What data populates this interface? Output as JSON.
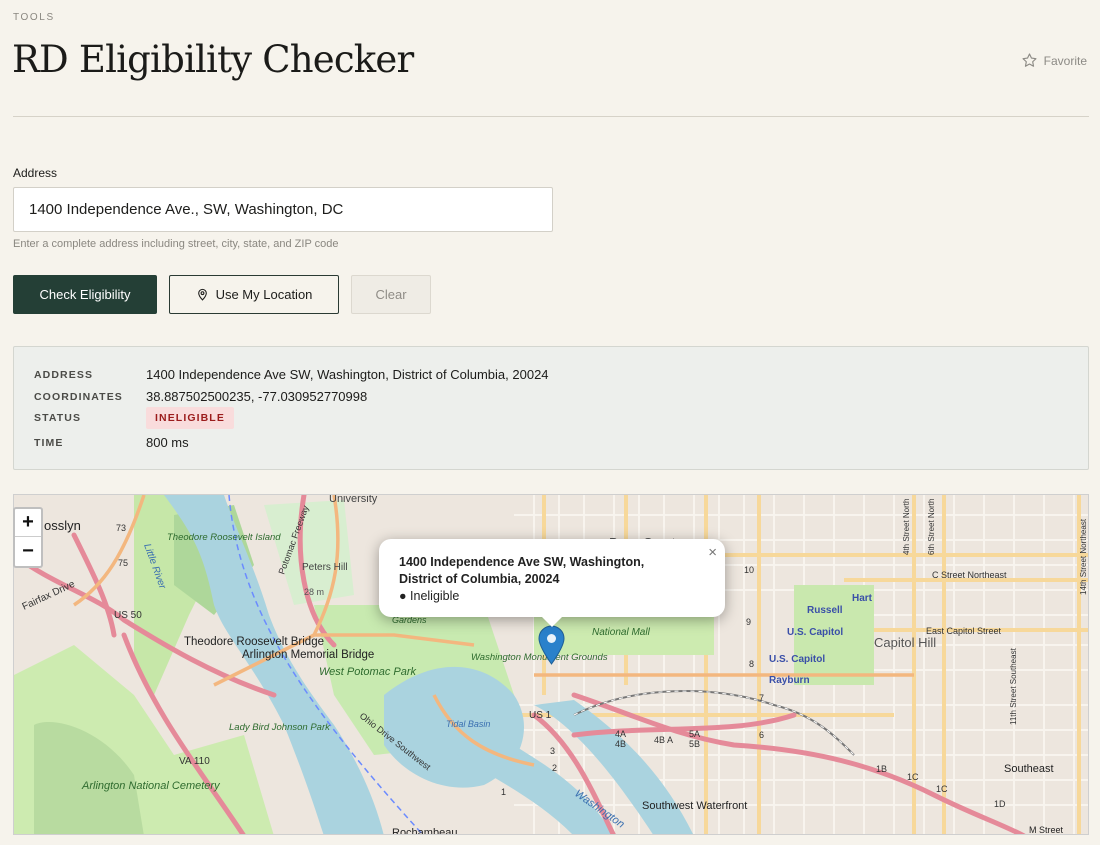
{
  "header": {
    "eyebrow": "TOOLS",
    "title": "RD Eligibility Checker",
    "favorite_label": "Favorite"
  },
  "form": {
    "address_label": "Address",
    "address_value": "1400 Independence Ave., SW, Washington, DC",
    "hint": "Enter a complete address including street, city, state, and ZIP code",
    "check_button": "Check Eligibility",
    "location_button": "Use My Location",
    "clear_button": "Clear"
  },
  "result": {
    "address_key": "ADDRESS",
    "address_value": "1400 Independence Ave SW, Washington, District of Columbia, 20024",
    "coords_key": "COORDINATES",
    "coords_value": "38.887502500235, -77.030952770998",
    "status_key": "STATUS",
    "status_value": "INELIGIBLE",
    "time_key": "TIME",
    "time_value": "800 ms"
  },
  "map": {
    "zoom_in": "+",
    "zoom_out": "−",
    "popup": {
      "address": "1400 Independence Ave SW, Washington, District of Columbia, 20024",
      "status": "● Ineligible",
      "close": "×"
    },
    "labels": {
      "rosslyn": "osslyn",
      "university": "University",
      "theodore_island": "Theodore Roosevelt Island",
      "theodore_bridge": "Theodore Roosevelt Bridge",
      "potomac_freeway": "Potomac Freeway",
      "peters_hill": "Peters Hill",
      "penn_quarter": "Penn Quarter",
      "fairfax_drive": "Fairfax Drive",
      "us50": "US 50",
      "little_river": "Little River",
      "arlington_bridge": "Arlington Memorial Bridge",
      "west_potomac": "West Potomac Park",
      "gardens": "Gardens",
      "washington_monument": "Washington Monument Grounds",
      "national_mall": "National Mall",
      "russell": "Russell",
      "hart": "Hart",
      "us_capitol_1": "U.S. Capitol",
      "us_capitol_2": "U.S. Capitol",
      "rayburn": "Rayburn",
      "capitol_hill": "Capitol Hill",
      "c_street": "C Street Northeast",
      "east_capitol": "East Capitol Street",
      "fourth_north": "4th Street North",
      "sixth_north": "6th Street North",
      "fourteenth_north": "14th Street Northeast",
      "eleventh_southeast": "11th Street Southeast",
      "lady_bird": "Lady Bird Johnson Park",
      "va110": "VA 110",
      "arlington_cemetery": "Arlington National Cemetery",
      "ohio_drive": "Ohio Drive Southwest",
      "tidal_basin": "Tidal Basin",
      "us1": "US 1",
      "southwest_waterfront": "Southwest Waterfront",
      "washington_channel": "Washington",
      "rochambeau": "Rochambeau",
      "southeast": "Southeast",
      "m_street": "M Street",
      "exit_4a": "4A",
      "exit_4b": "4B",
      "exit_4b_a": "4B A",
      "exit_5a": "5A",
      "exit_5b": "5B",
      "exit_1b": "1B",
      "exit_1c": "1C",
      "exit_1c2": "1C",
      "exit_1d": "1D",
      "num_10": "10",
      "num_9": "9",
      "num_8": "8",
      "num_7": "7",
      "num_6": "6",
      "num_73": "73",
      "num_75": "75",
      "num_28m": "28 m",
      "num_2": "2",
      "num_3": "3",
      "num_1": "1"
    }
  }
}
